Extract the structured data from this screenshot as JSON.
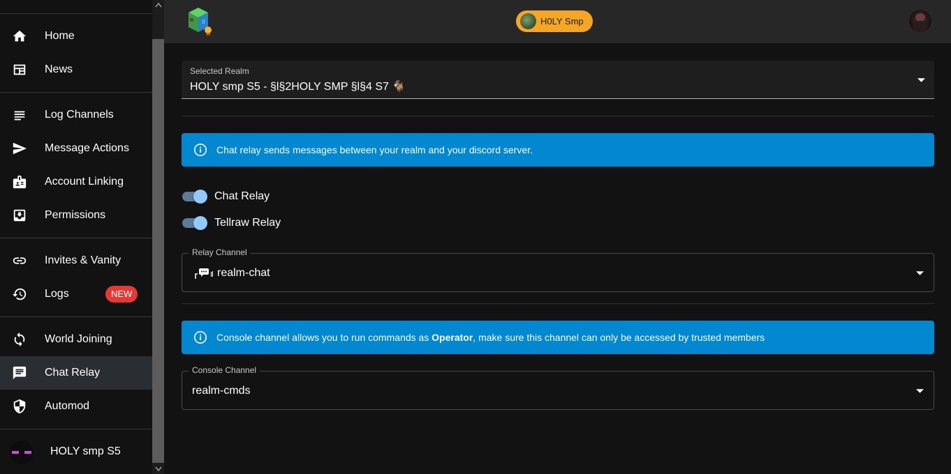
{
  "sidebar": {
    "items": [
      {
        "label": "Home",
        "icon": "home-icon"
      },
      {
        "label": "News",
        "icon": "news-icon"
      },
      {
        "label": "Log Channels",
        "icon": "list-icon"
      },
      {
        "label": "Message Actions",
        "icon": "send-icon"
      },
      {
        "label": "Account Linking",
        "icon": "badge-icon"
      },
      {
        "label": "Permissions",
        "icon": "inbox-icon"
      },
      {
        "label": "Invites & Vanity",
        "icon": "link-icon"
      },
      {
        "label": "Logs",
        "icon": "history-icon",
        "badge": "NEW"
      },
      {
        "label": "World Joining",
        "icon": "sync-icon"
      },
      {
        "label": "Chat Relay",
        "icon": "chat-icon",
        "active": true
      },
      {
        "label": "Automod",
        "icon": "shield-icon"
      }
    ],
    "realm": {
      "label": "HOLY smp S5"
    }
  },
  "topbar": {
    "realm_chip": "H0LY Smp"
  },
  "main": {
    "selected_realm": {
      "label": "Selected Realm",
      "value": "HOLY smp S5 - §l§2HOLY SMP §l§4 S7 🐐"
    },
    "relay_info": "Chat relay sends messages between your realm and your discord server.",
    "toggles": [
      {
        "label": "Chat Relay",
        "on": true
      },
      {
        "label": "Tellraw Relay",
        "on": true
      }
    ],
    "relay_channel": {
      "label": "Relay Channel",
      "value": "realm-chat"
    },
    "console_info": {
      "before": "Console channel allows you to run commands as ",
      "bold": "Operator",
      "after": ", make sure this channel can only be accessed by trusted members"
    },
    "console_channel": {
      "label": "Console Channel",
      "value": "realm-cmds"
    }
  },
  "colors": {
    "accent": "#0288d1",
    "chip": "#f5a623",
    "badge": "#e53935",
    "toggle": "#90caf9"
  }
}
